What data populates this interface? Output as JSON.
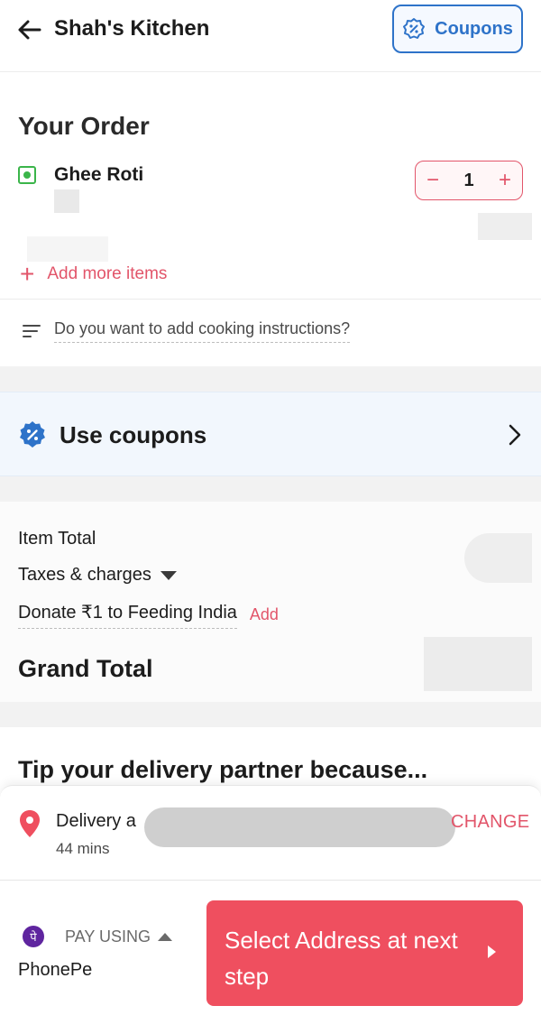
{
  "header": {
    "restaurant_name": "Shah's Kitchen",
    "coupons_button_label": "Coupons"
  },
  "order": {
    "title": "Your Order",
    "items": [
      {
        "name": "Ghee Roti",
        "quantity": "1",
        "veg": true
      }
    ],
    "add_more_label": "Add more items",
    "cooking_instructions_label": "Do you want to add cooking instructions?"
  },
  "coupons": {
    "label": "Use coupons"
  },
  "bill": {
    "item_total_label": "Item Total",
    "taxes_label": "Taxes & charges",
    "donate_label": "Donate ₹1 to Feeding India",
    "donate_add_label": "Add",
    "grand_total_label": "Grand Total"
  },
  "tip": {
    "title": "Tip your delivery partner because..."
  },
  "delivery": {
    "label": "Delivery a",
    "eta": "44 mins",
    "change_label": "CHANGE"
  },
  "payment": {
    "pay_using_label": "PAY USING",
    "method": "PhonePe",
    "method_icon_glyph": "पे",
    "cta_label": "Select Address at next step"
  },
  "colors": {
    "accent_red": "#ef4f5f",
    "coupon_blue": "#2e73c9",
    "veg_green": "#3bb54a",
    "phonepe_purple": "#5f259f"
  }
}
